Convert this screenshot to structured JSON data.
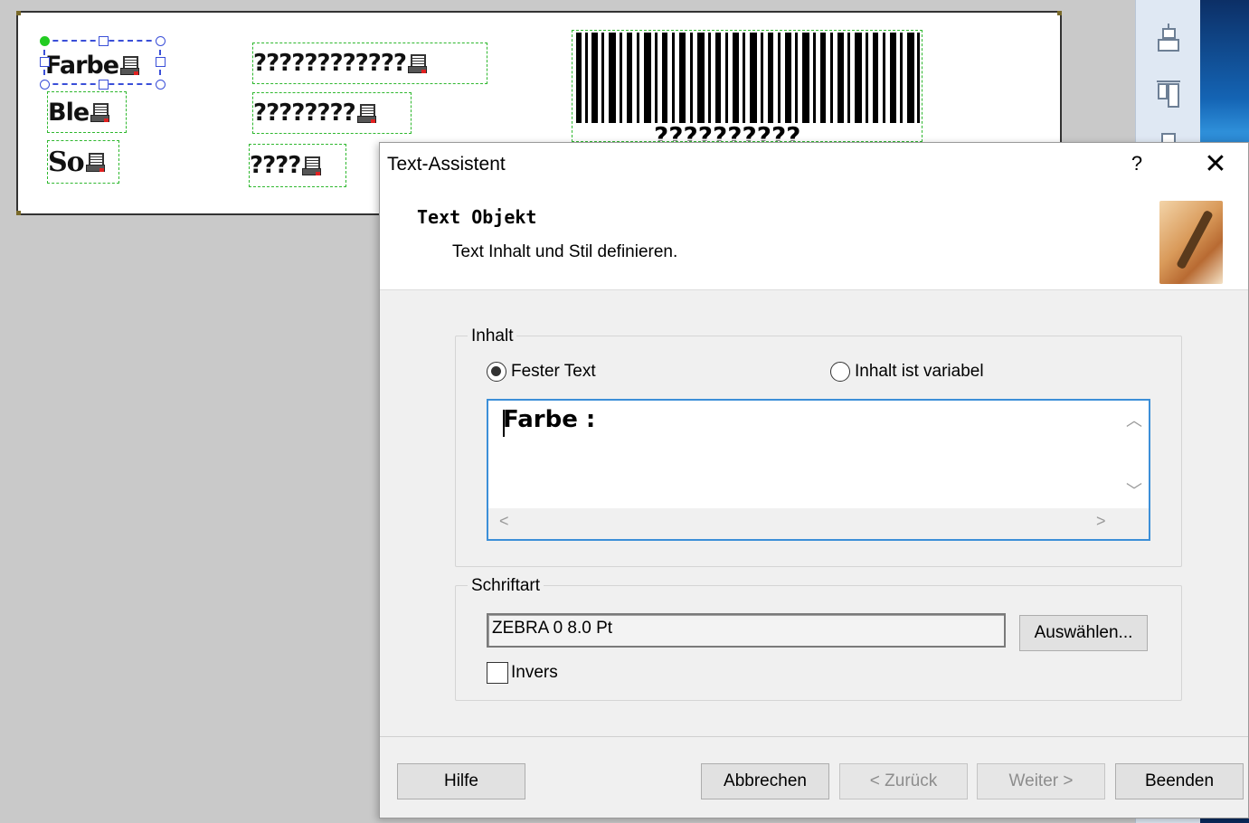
{
  "editor": {
    "label_objects": [
      {
        "text": "Farbe"
      },
      {
        "text": "Ble"
      },
      {
        "text": "So"
      },
      {
        "text": "????????????"
      },
      {
        "text": "????????"
      },
      {
        "text": "????"
      }
    ],
    "barcode": {
      "text": "??????????"
    },
    "toolbar_icons": [
      "align-top-icon",
      "align-left-icon",
      "align-bottom-icon"
    ]
  },
  "dialog": {
    "title": "Text-Assistent",
    "help_glyph": "?",
    "close_glyph": "✕",
    "heading": "Text Objekt",
    "subheading": "Text Inhalt und Stil definieren.",
    "content_group": {
      "label": "Inhalt",
      "radio_fixed": {
        "label": "Fester Text",
        "checked": true
      },
      "radio_variable": {
        "label": "Inhalt ist variabel",
        "checked": false
      },
      "text_value": "Farbe :"
    },
    "font_group": {
      "label": "Schriftart",
      "font_value": "ZEBRA 0 8.0 Pt",
      "select_button": "Auswählen...",
      "invert_label": "Invers"
    },
    "buttons": {
      "help": "Hilfe",
      "cancel": "Abbrechen",
      "back": "< Zurück",
      "next": "Weiter >",
      "finish": "Beenden"
    }
  },
  "colors": {
    "selection": "#3a4fd8",
    "object_outline": "#2fb82f",
    "focus_border": "#3c8fd8"
  }
}
